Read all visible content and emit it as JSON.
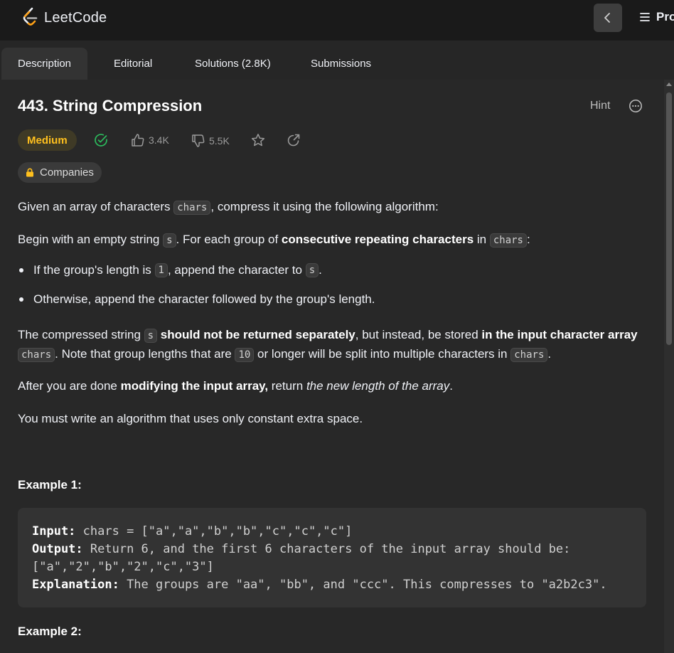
{
  "brand": {
    "name": "LeetCode"
  },
  "nav": {
    "menu_label": "Pro"
  },
  "tabs": [
    {
      "label": "Description"
    },
    {
      "label": "Editorial"
    },
    {
      "label": "Solutions (2.8K)"
    },
    {
      "label": "Submissions"
    }
  ],
  "problem": {
    "title": "443. String Compression",
    "hint_label": "Hint",
    "difficulty": "Medium",
    "likes": "3.4K",
    "dislikes": "5.5K",
    "companies_label": "Companies"
  },
  "description": {
    "p1_a": "Given an array of characters ",
    "p1_code": "chars",
    "p1_b": ", compress it using the following algorithm:",
    "p2_a": "Begin with an empty string ",
    "p2_code1": "s",
    "p2_b": ". For each group of ",
    "p2_bold": "consecutive repeating characters",
    "p2_c": " in ",
    "p2_code2": "chars",
    "p2_d": ":",
    "b1_a": "If the group's length is ",
    "b1_code1": "1",
    "b1_b": ", append the character to ",
    "b1_code2": "s",
    "b1_c": ".",
    "b2": "Otherwise, append the character followed by the group's length.",
    "p3_a": "The compressed string ",
    "p3_code1": "s",
    "p3_bold1": " should not be returned separately",
    "p3_b": ", but instead, be stored ",
    "p3_bold2": "in the input character array",
    "p3_code2": "chars",
    "p3_c": ". Note that group lengths that are ",
    "p3_code3": "10",
    "p3_d": " or longer will be split into multiple characters in ",
    "p3_code4": "chars",
    "p3_e": ".",
    "p4_a": "After you are done ",
    "p4_bold": "modifying the input array,",
    "p4_b": " return ",
    "p4_italic": "the new length of the array",
    "p4_c": ".",
    "p5": "You must write an algorithm that uses only constant extra space."
  },
  "examples": [
    {
      "heading": "Example 1:",
      "input_label": "Input:",
      "input": " chars = [\"a\",\"a\",\"b\",\"b\",\"c\",\"c\",\"c\"]",
      "output_label": "Output:",
      "output": " Return 6, and the first 6 characters of the input array should be:",
      "output_2": "[\"a\",\"2\",\"b\",\"2\",\"c\",\"3\"]",
      "explanation_label": "Explanation:",
      "explanation": " The groups are \"aa\", \"bb\", and \"ccc\". This compresses to \"a2b2c3\"."
    },
    {
      "heading": "Example 2:"
    }
  ],
  "colors": {
    "medium": "#ffc01e",
    "solved": "#2cbb5d",
    "background": "#282828"
  }
}
